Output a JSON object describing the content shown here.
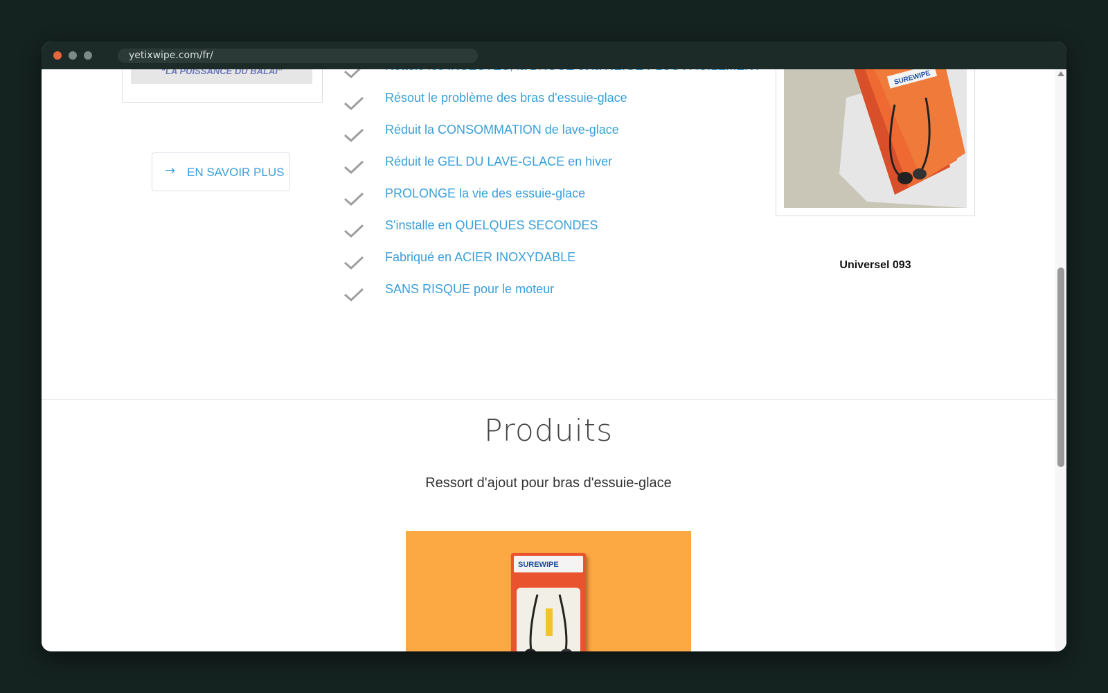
{
  "browser": {
    "url": "yetixwipe.com/fr/"
  },
  "logo": {
    "slogan": "“LA PUISSANCE DU BALAI”"
  },
  "learn_more": {
    "label": "EN SAVOIR PLUS",
    "icon": "arrow-right-icon"
  },
  "features": [
    "Nettoie les INSECTES, la BROUE et la NEIGE PLUS FACILEMENT",
    "Résout le problème des bras d'essuie-glace",
    "Réduit la CONSOMMATION de lave-glace",
    "Réduit le GEL DU LAVE-GLACE en hiver",
    "PROLONGE la vie des essuie-glace",
    "S'installe en QUELQUES SECONDES",
    "Fabriqué en ACIER INOXYDABLE",
    "SANS RISQUE pour le moteur"
  ],
  "product_display": {
    "caption": "Universel 093",
    "package_brand": "SUREWIPE"
  },
  "products_section": {
    "title": "Produits",
    "subtitle": "Ressort d'ajout pour bras d'essuie-glace",
    "card_color": "#fca843"
  },
  "colors": {
    "accent": "#3a9fd8",
    "check": "#9e9e9e"
  }
}
